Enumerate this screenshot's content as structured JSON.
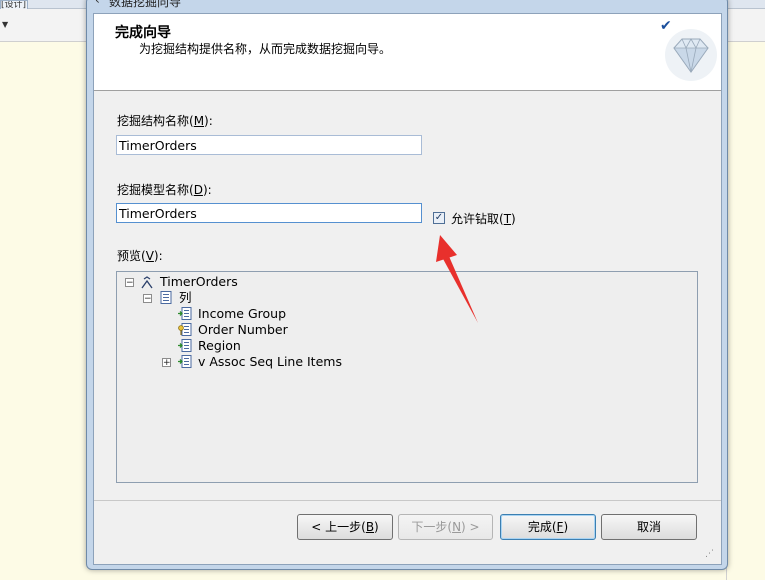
{
  "background": {
    "tab_label": "[设计]"
  },
  "dialog": {
    "title": "数据挖掘向导",
    "header": {
      "title": "完成向导",
      "subtitle": "为挖掘结构提供名称，从而完成数据挖掘向导。"
    },
    "structure_name": {
      "label": "挖掘结构名称(",
      "hotkey": "M",
      "suffix": "):",
      "value": "TimerOrders"
    },
    "model_name": {
      "label": "挖掘模型名称(",
      "hotkey": "D",
      "suffix": "):",
      "value": "TimerOrders"
    },
    "drillthrough": {
      "label": "允许钻取(",
      "hotkey": "T",
      "suffix": ")",
      "checked": true
    },
    "preview": {
      "label": "预览(",
      "hotkey": "V",
      "suffix": "):",
      "root": "TimerOrders",
      "columns_label": "列",
      "items": [
        "Income Group",
        "Order Number",
        "Region",
        "v Assoc Seq Line Items"
      ]
    },
    "buttons": {
      "back": {
        "prefix": "< 上一步(",
        "hotkey": "B",
        "suffix": ")"
      },
      "next": {
        "prefix": "下一步(",
        "hotkey": "N",
        "suffix": ") >"
      },
      "finish": {
        "prefix": "完成(",
        "hotkey": "F",
        "suffix": ")"
      },
      "cancel": "取消"
    }
  },
  "colors": {
    "annotation_arrow": "#e8302c",
    "header_bg": "#ffffff",
    "dialog_frame": "#c4d6ea"
  }
}
